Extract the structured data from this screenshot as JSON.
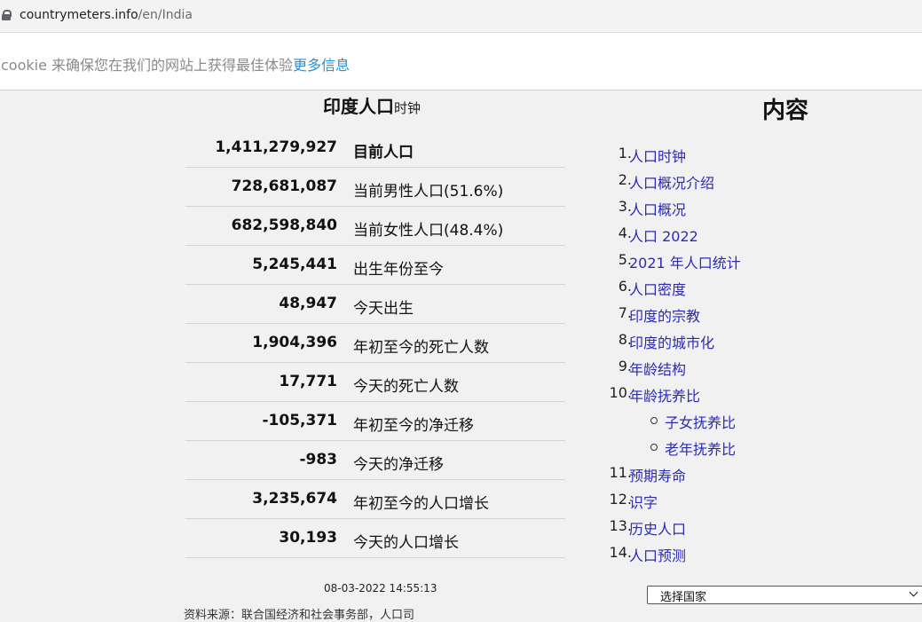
{
  "browser": {
    "url_domain": "countrymeters.info",
    "url_path": "/en/India"
  },
  "cookie_banner": {
    "text": "cookie 来确保您在我们的网站上获得最佳体验",
    "link": "更多信息"
  },
  "clock": {
    "title_main": "印度人口",
    "title_sub": "时钟",
    "rows": [
      {
        "value": "1,411,279,927",
        "label": "目前人口"
      },
      {
        "value": "728,681,087",
        "label": "当前男性人口(51.6%)"
      },
      {
        "value": "682,598,840",
        "label": "当前女性人口(48.4%)"
      },
      {
        "value": "5,245,441",
        "label": "出生年份至今"
      },
      {
        "value": "48,947",
        "label": "今天出生"
      },
      {
        "value": "1,904,396",
        "label": "年初至今的死亡人数"
      },
      {
        "value": "17,771",
        "label": "今天的死亡人数"
      },
      {
        "value": "-105,371",
        "label": "年初至今的净迁移"
      },
      {
        "value": "-983",
        "label": "今天的净迁移"
      },
      {
        "value": "3,235,674",
        "label": "年初至今的人口增长"
      },
      {
        "value": "30,193",
        "label": "今天的人口增长"
      }
    ],
    "timestamp": "08-03-2022 14:55:13",
    "source": "资料来源：联合国经济和社会事务部，人口司"
  },
  "toc": {
    "title": "内容",
    "items": [
      {
        "num": "1.",
        "label": "人口时钟"
      },
      {
        "num": "2.",
        "label": "人口概况介绍"
      },
      {
        "num": "3.",
        "label": "人口概况"
      },
      {
        "num": "4.",
        "label": "人口 2022"
      },
      {
        "num": "5.",
        "label": "2021 年人口统计"
      },
      {
        "num": "6.",
        "label": "人口密度"
      },
      {
        "num": "7.",
        "label": "印度的宗教"
      },
      {
        "num": "8.",
        "label": "印度的城市化"
      },
      {
        "num": "9.",
        "label": "年龄结构"
      },
      {
        "num": "10.",
        "label": "年龄抚养比"
      },
      {
        "label": "子女抚养比"
      },
      {
        "label": "老年抚养比"
      },
      {
        "num": "11.",
        "label": "预期寿命"
      },
      {
        "num": "12.",
        "label": "识字"
      },
      {
        "num": "13.",
        "label": "历史人口"
      },
      {
        "num": "14.",
        "label": "人口预测"
      }
    ]
  },
  "country_select": {
    "selected": "选择国家"
  }
}
